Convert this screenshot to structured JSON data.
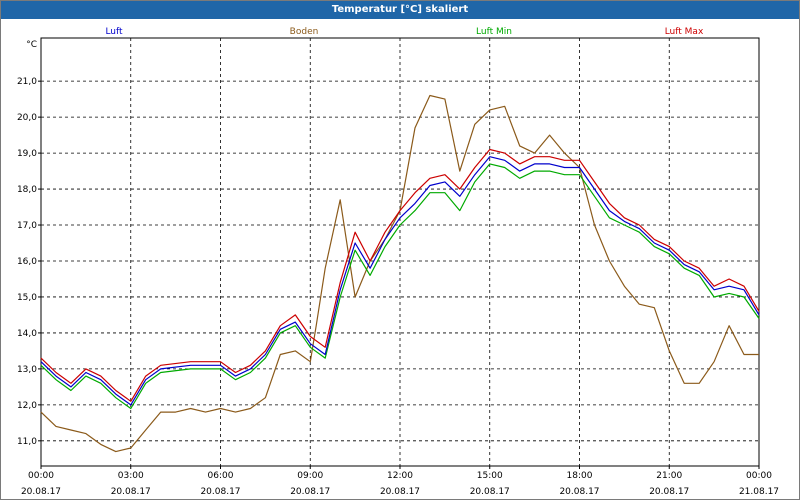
{
  "window": {
    "title": "Temperatur [°C] skaliert"
  },
  "chart_data": {
    "type": "line",
    "title": "Temperatur [°C] skaliert",
    "yunit": "°C",
    "ylim": [
      10.3,
      22.2
    ],
    "xlim": [
      0,
      24
    ],
    "grid": true,
    "legend_position": "top",
    "y_ticks": [
      "11,0",
      "12,0",
      "13,0",
      "14,0",
      "15,0",
      "16,0",
      "17,0",
      "18,0",
      "19,0",
      "20,0",
      "21,0"
    ],
    "y_tick_values": [
      11,
      12,
      13,
      14,
      15,
      16,
      17,
      18,
      19,
      20,
      21
    ],
    "x_ticks": [
      {
        "time": "00:00",
        "date": "20.08.17"
      },
      {
        "time": "03:00",
        "date": "20.08.17"
      },
      {
        "time": "06:00",
        "date": "20.08.17"
      },
      {
        "time": "09:00",
        "date": "20.08.17"
      },
      {
        "time": "12:00",
        "date": "20.08.17"
      },
      {
        "time": "15:00",
        "date": "20.08.17"
      },
      {
        "time": "18:00",
        "date": "20.08.17"
      },
      {
        "time": "21:00",
        "date": "20.08.17"
      },
      {
        "time": "00:00",
        "date": "21.08.17"
      }
    ],
    "x_tick_values": [
      0,
      3,
      6,
      9,
      12,
      15,
      18,
      21,
      24
    ],
    "series": [
      {
        "name": "Luft",
        "color": "#0000cc",
        "x": [
          0,
          0.5,
          1,
          1.5,
          2,
          2.5,
          3,
          3.5,
          4,
          5,
          6,
          6.5,
          7,
          7.5,
          8,
          8.5,
          9,
          9.5,
          10,
          10.5,
          11,
          11.5,
          12,
          12.5,
          13,
          13.5,
          14,
          14.5,
          15,
          15.5,
          16,
          16.5,
          17,
          17.5,
          18,
          18.5,
          19,
          19.5,
          20,
          20.5,
          21,
          21.5,
          22,
          22.5,
          23,
          23.5,
          24
        ],
        "values": [
          13.2,
          12.8,
          12.5,
          12.9,
          12.7,
          12.3,
          12.0,
          12.7,
          13.0,
          13.1,
          13.1,
          12.8,
          13.0,
          13.4,
          14.1,
          14.3,
          13.7,
          13.4,
          15.2,
          16.5,
          15.8,
          16.6,
          17.2,
          17.6,
          18.1,
          18.2,
          17.8,
          18.4,
          18.9,
          18.8,
          18.5,
          18.7,
          18.7,
          18.6,
          18.6,
          18.0,
          17.4,
          17.1,
          16.9,
          16.5,
          16.3,
          15.9,
          15.7,
          15.2,
          15.3,
          15.2,
          14.5
        ]
      },
      {
        "name": "Boden",
        "color": "#8b5a1a",
        "x": [
          0,
          0.5,
          1,
          1.5,
          2,
          2.5,
          3,
          3.5,
          4,
          4.5,
          5,
          5.5,
          6,
          6.5,
          7,
          7.5,
          8,
          8.5,
          9,
          9.2,
          9.5,
          10,
          10.5,
          11,
          11.5,
          12,
          12.5,
          13,
          13.5,
          14,
          14.5,
          15,
          15.5,
          16,
          16.5,
          17,
          17.5,
          18,
          18.5,
          19,
          19.5,
          20,
          20.5,
          21,
          21.5,
          22,
          22.5,
          23,
          23.5,
          24
        ],
        "values": [
          11.8,
          11.4,
          11.3,
          11.2,
          10.9,
          10.7,
          10.8,
          11.3,
          11.8,
          11.8,
          11.9,
          11.8,
          11.9,
          11.8,
          11.9,
          12.2,
          13.4,
          13.5,
          13.2,
          14.2,
          15.8,
          17.7,
          15.0,
          16.0,
          16.6,
          17.4,
          19.7,
          20.6,
          20.5,
          18.5,
          19.8,
          20.2,
          20.3,
          19.2,
          19.0,
          19.5,
          19.0,
          18.6,
          17.0,
          16.0,
          15.3,
          14.8,
          14.7,
          13.5,
          12.6,
          12.6,
          13.2,
          14.2,
          13.4,
          13.4
        ]
      },
      {
        "name": "Luft Min",
        "color": "#00aa00",
        "x": [
          0,
          0.5,
          1,
          1.5,
          2,
          2.5,
          3,
          3.5,
          4,
          5,
          6,
          6.5,
          7,
          7.5,
          8,
          8.5,
          9,
          9.5,
          10,
          10.5,
          11,
          11.5,
          12,
          12.5,
          13,
          13.5,
          14,
          14.5,
          15,
          15.5,
          16,
          16.5,
          17,
          17.5,
          18,
          18.5,
          19,
          19.5,
          20,
          20.5,
          21,
          21.5,
          22,
          22.5,
          23,
          23.5,
          24
        ],
        "values": [
          13.1,
          12.7,
          12.4,
          12.8,
          12.6,
          12.2,
          11.9,
          12.6,
          12.9,
          13.0,
          13.0,
          12.7,
          12.9,
          13.3,
          14.0,
          14.2,
          13.6,
          13.3,
          15.0,
          16.3,
          15.6,
          16.4,
          17.0,
          17.4,
          17.9,
          17.9,
          17.4,
          18.2,
          18.7,
          18.6,
          18.3,
          18.5,
          18.5,
          18.4,
          18.4,
          17.8,
          17.2,
          17.0,
          16.8,
          16.4,
          16.2,
          15.8,
          15.6,
          15.0,
          15.1,
          15.0,
          14.4
        ]
      },
      {
        "name": "Luft Max",
        "color": "#cc0000",
        "x": [
          0,
          0.5,
          1,
          1.5,
          2,
          2.5,
          3,
          3.5,
          4,
          5,
          6,
          6.5,
          7,
          7.5,
          8,
          8.5,
          9,
          9.5,
          10,
          10.5,
          11,
          11.5,
          12,
          12.5,
          13,
          13.5,
          14,
          14.5,
          15,
          15.5,
          16,
          16.5,
          17,
          17.5,
          18,
          18.5,
          19,
          19.5,
          20,
          20.5,
          21,
          21.5,
          22,
          22.5,
          23,
          23.5,
          24
        ],
        "values": [
          13.3,
          12.9,
          12.6,
          13.0,
          12.8,
          12.4,
          12.1,
          12.8,
          13.1,
          13.2,
          13.2,
          12.9,
          13.1,
          13.5,
          14.2,
          14.5,
          13.9,
          13.6,
          15.4,
          16.8,
          16.0,
          16.8,
          17.4,
          17.9,
          18.3,
          18.4,
          18.0,
          18.6,
          19.1,
          19.0,
          18.7,
          18.9,
          18.9,
          18.8,
          18.8,
          18.2,
          17.6,
          17.2,
          17.0,
          16.6,
          16.4,
          16.0,
          15.8,
          15.3,
          15.5,
          15.3,
          14.6
        ]
      }
    ]
  }
}
